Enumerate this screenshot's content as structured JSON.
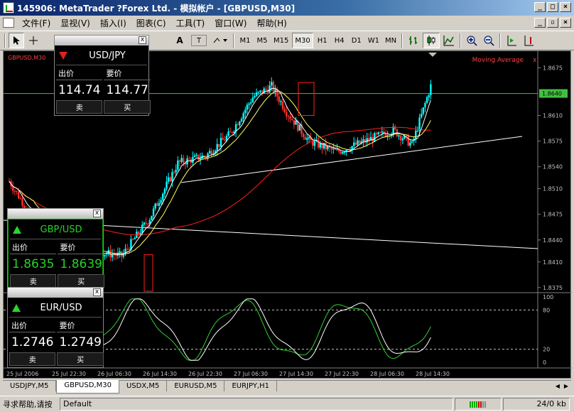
{
  "window": {
    "title": "145906: MetaTrader ?Forex Ltd. - 模拟帐户 - [GBPUSD,M30]"
  },
  "menu": [
    "文件(F)",
    "显视(V)",
    "插入(I)",
    "图表(C)",
    "工具(T)",
    "窗口(W)",
    "帮助(H)"
  ],
  "toolbar": {
    "text_tool": "A",
    "label_tool": "T",
    "timeframes": [
      "M1",
      "M5",
      "M15",
      "M30",
      "H1",
      "H4",
      "D1",
      "W1",
      "MN"
    ],
    "active_timeframe": "M30"
  },
  "chart": {
    "symbol_label": "GBPUSD,M30",
    "indicator_label": "Moving Average",
    "indicator_close": "x",
    "current_price": "1.8640",
    "price_ticks": [
      "1.8675",
      "1.8640",
      "1.8610",
      "1.8575",
      "1.8540",
      "1.8510",
      "1.8475",
      "1.8440",
      "1.8410",
      "1.8375"
    ],
    "osc_ticks": [
      "100",
      "80",
      "20",
      "0"
    ],
    "time_ticks": [
      "25 Jul 2006",
      "25 Jul 22:30",
      "26 Jul 06:30",
      "26 Jul 14:30",
      "26 Jul 22:30",
      "27 Jul 06:30",
      "27 Jul 14:30",
      "27 Jul 22:30",
      "28 Jul 06:30",
      "28 Jul 14:30"
    ],
    "colors": {
      "bull": "#00ffff",
      "bear": "#ff3030",
      "ma_red": "#ff2020",
      "ma_yellow": "#ffff60",
      "ma_white": "#ffffff",
      "osc_main": "#ffffff",
      "osc_signal": "#30d030",
      "price_line": "#40c040",
      "box": "#ff2020"
    }
  },
  "panels": {
    "usdjpy": {
      "symbol": "USD/JPY",
      "direction": "down",
      "bid_label": "出价",
      "ask_label": "要价",
      "bid": "114.74",
      "ask": "114.77",
      "sell": "卖",
      "buy": "买"
    },
    "gbpusd": {
      "symbol": "GBP/USD",
      "direction": "up",
      "bid_label": "出价",
      "ask_label": "要价",
      "bid": "1.8635",
      "ask": "1.8639",
      "sell": "卖",
      "buy": "买"
    },
    "eurusd": {
      "symbol": "EUR/USD",
      "direction": "up",
      "bid_label": "出价",
      "ask_label": "要价",
      "bid": "1.2746",
      "ask": "1.2749",
      "sell": "卖",
      "buy": "买"
    }
  },
  "tabs": [
    "USDJPY,M5",
    "GBPUSD,M30",
    "USDX,M5",
    "EURUSD,M5",
    "EURJPY,H1"
  ],
  "active_tab": "GBPUSD,M30",
  "status": {
    "help": "寻求帮助,请按",
    "profile": "Default",
    "traffic": "24/0 kb"
  },
  "close_glyph": "x"
}
